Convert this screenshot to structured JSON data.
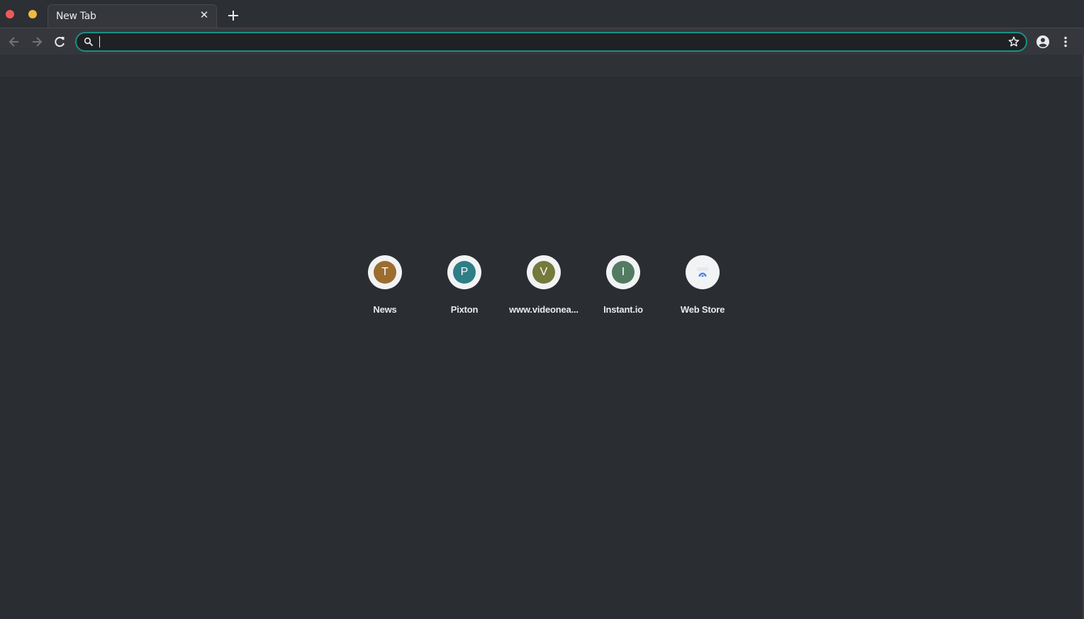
{
  "window": {
    "traffic_lights": {
      "close_color": "#ee5a5a",
      "minimize_color": "#f0b941"
    }
  },
  "tabs": [
    {
      "title": "New Tab",
      "close_symbol": "✕"
    }
  ],
  "toolbar": {
    "back_icon": "arrow-left-icon",
    "forward_icon": "arrow-right-icon",
    "reload_icon": "reload-icon",
    "omnibox": {
      "value": "",
      "placeholder": "",
      "focus_ring_color": "#1a8f86"
    },
    "bookmark_icon": "star-icon",
    "profile_icon": "account-circle-icon",
    "menu_icon": "more-vert-icon"
  },
  "shortcuts": [
    {
      "letter": "T",
      "label": "News",
      "color": "#9b6d30"
    },
    {
      "letter": "P",
      "label": "Pixton",
      "color": "#2f7d87"
    },
    {
      "letter": "V",
      "label": "www.videoneа...",
      "color": "#757a3c"
    },
    {
      "letter": "I",
      "label": "Instant.io",
      "color": "#527b62"
    },
    {
      "letter": "",
      "label": "Web Store",
      "color": "#4285f4",
      "icon": "web-store-icon"
    }
  ]
}
